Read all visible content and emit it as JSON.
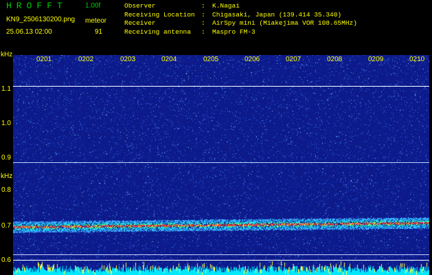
{
  "app": {
    "title": "HROFFT",
    "version": "1.00f"
  },
  "file": {
    "name": "KN9_2506130200.png",
    "datetime": "25.06.13 02:00"
  },
  "meteor": {
    "label": "meteor",
    "count": "91"
  },
  "meta": [
    {
      "key": "Observer",
      "value": "K.Nagai"
    },
    {
      "key": "Receiving Location",
      "value": "Chigasaki, Japan (139.414 35.340)"
    },
    {
      "key": "Receiver",
      "value": "AirSpy mini (Miakejima VOR 108.65MHz)"
    },
    {
      "key": "Receiving antenna",
      "value": "Maspro FM-3"
    }
  ],
  "axis": {
    "unit": "kHz",
    "y_labels": [
      "1.1",
      "1.0",
      "0.9",
      "0.8",
      "0.7",
      "0.6"
    ],
    "x_labels": [
      "0201",
      "0202",
      "0203",
      "0204",
      "0205",
      "0206",
      "0207",
      "0208",
      "0209",
      "0210"
    ]
  },
  "colors": {
    "text": "#ffff00",
    "title": "#00d000",
    "background": "#0c1a8a",
    "signal": "#ff3030"
  }
}
